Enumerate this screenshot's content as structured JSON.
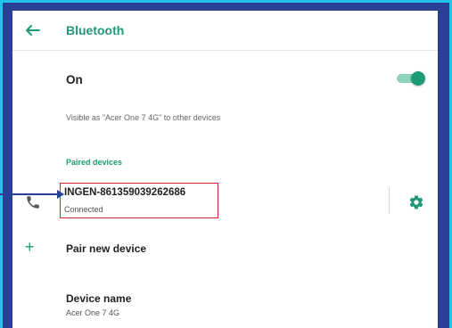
{
  "appbar": {
    "title": "Bluetooth",
    "back_icon": "arrow-left-icon"
  },
  "bluetooth_toggle": {
    "label": "On",
    "state": "on"
  },
  "visibility": {
    "text": "Visible as \"Acer One 7 4G\" to other devices"
  },
  "paired_section": {
    "header": "Paired devices",
    "devices": [
      {
        "name": "INGEN-861359039262686",
        "status": "Connected",
        "icon": "phone-icon",
        "settings_icon": "gear-icon"
      }
    ]
  },
  "pair_new": {
    "label": "Pair new device",
    "icon": "plus-icon"
  },
  "device_name": {
    "title": "Device name",
    "value": "Acer One 7 4G"
  },
  "colors": {
    "accent": "#1f9a77",
    "frame_outer": "#1fc4e6",
    "frame_inner": "#2a3f96",
    "highlight": "#d9262c"
  }
}
